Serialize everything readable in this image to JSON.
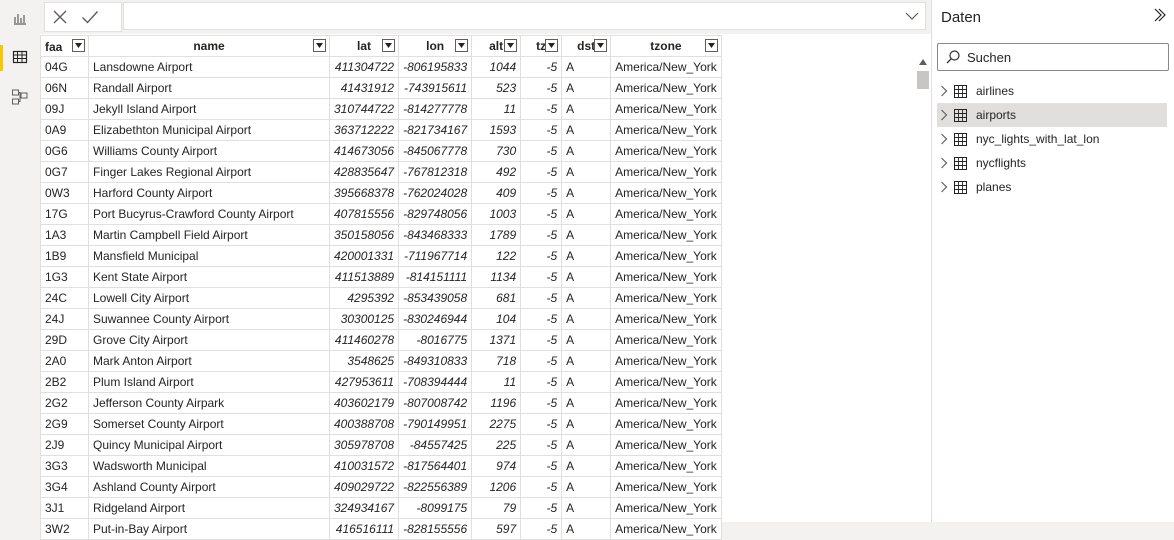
{
  "left_rail": {
    "items": [
      {
        "name": "report-view-icon",
        "active": false
      },
      {
        "name": "table-view-icon",
        "active": true
      },
      {
        "name": "model-view-icon",
        "active": false
      }
    ]
  },
  "formula_bar": {
    "value": ""
  },
  "table": {
    "columns": [
      "faa",
      "name",
      "lat",
      "lon",
      "alt",
      "tz",
      "dst",
      "tzone"
    ],
    "rows": [
      [
        "04G",
        "Lansdowne Airport",
        "411304722",
        "-806195833",
        "1044",
        "-5",
        "A",
        "America/New_York"
      ],
      [
        "06N",
        "Randall Airport",
        "41431912",
        "-743915611",
        "523",
        "-5",
        "A",
        "America/New_York"
      ],
      [
        "09J",
        "Jekyll Island Airport",
        "310744722",
        "-814277778",
        "11",
        "-5",
        "A",
        "America/New_York"
      ],
      [
        "0A9",
        "Elizabethton Municipal Airport",
        "363712222",
        "-821734167",
        "1593",
        "-5",
        "A",
        "America/New_York"
      ],
      [
        "0G6",
        "Williams County Airport",
        "414673056",
        "-845067778",
        "730",
        "-5",
        "A",
        "America/New_York"
      ],
      [
        "0G7",
        "Finger Lakes Regional Airport",
        "428835647",
        "-767812318",
        "492",
        "-5",
        "A",
        "America/New_York"
      ],
      [
        "0W3",
        "Harford County Airport",
        "395668378",
        "-762024028",
        "409",
        "-5",
        "A",
        "America/New_York"
      ],
      [
        "17G",
        "Port Bucyrus-Crawford County Airport",
        "407815556",
        "-829748056",
        "1003",
        "-5",
        "A",
        "America/New_York"
      ],
      [
        "1A3",
        "Martin Campbell Field Airport",
        "350158056",
        "-843468333",
        "1789",
        "-5",
        "A",
        "America/New_York"
      ],
      [
        "1B9",
        "Mansfield Municipal",
        "420001331",
        "-711967714",
        "122",
        "-5",
        "A",
        "America/New_York"
      ],
      [
        "1G3",
        "Kent State Airport",
        "411513889",
        "-814151111",
        "1134",
        "-5",
        "A",
        "America/New_York"
      ],
      [
        "24C",
        "Lowell City Airport",
        "4295392",
        "-853439058",
        "681",
        "-5",
        "A",
        "America/New_York"
      ],
      [
        "24J",
        "Suwannee County Airport",
        "30300125",
        "-830246944",
        "104",
        "-5",
        "A",
        "America/New_York"
      ],
      [
        "29D",
        "Grove City Airport",
        "411460278",
        "-8016775",
        "1371",
        "-5",
        "A",
        "America/New_York"
      ],
      [
        "2A0",
        "Mark Anton Airport",
        "3548625",
        "-849310833",
        "718",
        "-5",
        "A",
        "America/New_York"
      ],
      [
        "2B2",
        "Plum Island Airport",
        "427953611",
        "-708394444",
        "11",
        "-5",
        "A",
        "America/New_York"
      ],
      [
        "2G2",
        "Jefferson County Airpark",
        "403602179",
        "-807008742",
        "1196",
        "-5",
        "A",
        "America/New_York"
      ],
      [
        "2G9",
        "Somerset County Airport",
        "400388708",
        "-790149951",
        "2275",
        "-5",
        "A",
        "America/New_York"
      ],
      [
        "2J9",
        "Quincy Municipal Airport",
        "305978708",
        "-84557425",
        "225",
        "-5",
        "A",
        "America/New_York"
      ],
      [
        "3G3",
        "Wadsworth Municipal",
        "410031572",
        "-817564401",
        "974",
        "-5",
        "A",
        "America/New_York"
      ],
      [
        "3G4",
        "Ashland County Airport",
        "409029722",
        "-822556389",
        "1206",
        "-5",
        "A",
        "America/New_York"
      ],
      [
        "3J1",
        "Ridgeland Airport",
        "324934167",
        "-8099175",
        "79",
        "-5",
        "A",
        "America/New_York"
      ],
      [
        "3W2",
        "Put-in-Bay Airport",
        "416516111",
        "-828155556",
        "597",
        "-5",
        "A",
        "America/New_York"
      ]
    ]
  },
  "data_pane": {
    "title": "Daten",
    "search_placeholder": "Suchen",
    "tables": [
      {
        "label": "airlines",
        "selected": false
      },
      {
        "label": "airports",
        "selected": true
      },
      {
        "label": "nyc_lights_with_lat_lon",
        "selected": false
      },
      {
        "label": "nycflights",
        "selected": false
      },
      {
        "label": "planes",
        "selected": false
      }
    ]
  }
}
